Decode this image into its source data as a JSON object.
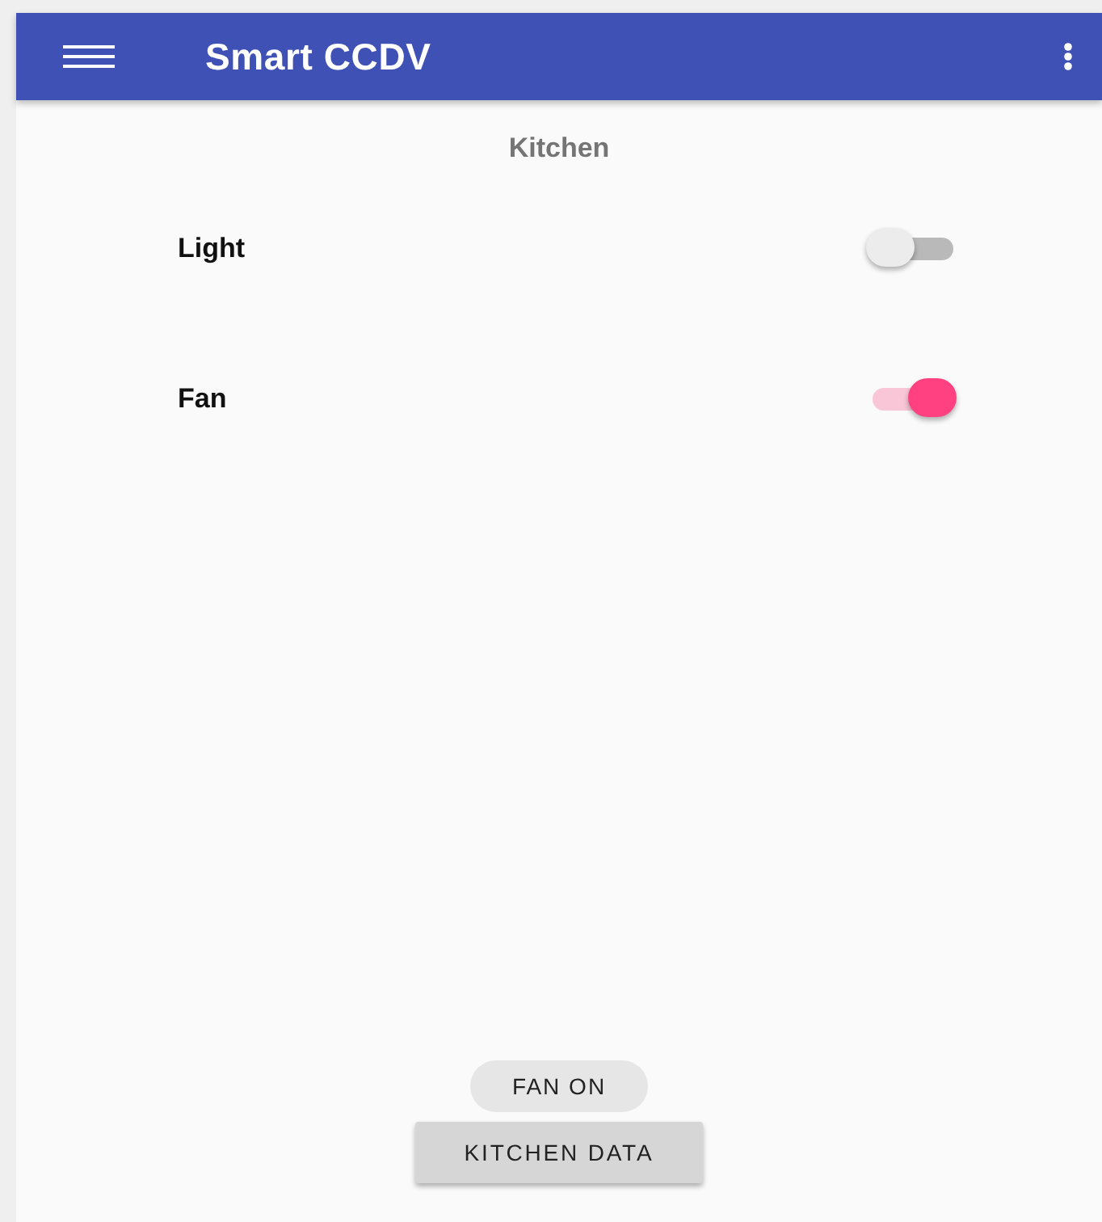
{
  "app_bar": {
    "title": "Smart CCDV"
  },
  "section_title": "Kitchen",
  "switches": [
    {
      "label": "Light",
      "on": false
    },
    {
      "label": "Fan",
      "on": true
    }
  ],
  "button": "KITCHEN DATA",
  "toast": "FAN ON"
}
